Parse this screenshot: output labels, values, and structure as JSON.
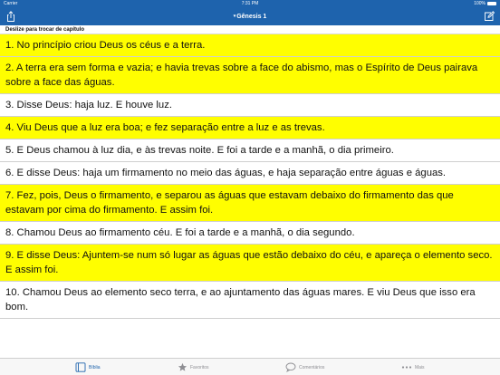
{
  "status_bar": {
    "carrier": "Carrier",
    "time": "7:31 PM",
    "battery": "100%"
  },
  "nav_bar": {
    "chevron": "▾",
    "title": "Gênesis 1",
    "left_icon": "share-icon",
    "right_icon": "compose-icon"
  },
  "hint": "Deslize para trocar de capítulo",
  "verses": [
    {
      "text": "1. No princípio criou Deus os céus e a terra.",
      "highlighted": true
    },
    {
      "text": "2. A terra era sem forma e vazia; e havia trevas sobre a face do abismo, mas o Espírito de Deus pairava sobre a face das águas.",
      "highlighted": true
    },
    {
      "text": "3. Disse Deus: haja luz. E houve luz.",
      "highlighted": false
    },
    {
      "text": "4. Viu Deus que a luz era boa; e fez separação entre a luz e as trevas.",
      "highlighted": true
    },
    {
      "text": "5. E Deus chamou à luz dia, e às trevas noite. E foi a tarde e a manhã, o dia primeiro.",
      "highlighted": false
    },
    {
      "text": "6. E disse Deus: haja um firmamento no meio das águas, e haja separação entre águas e águas.",
      "highlighted": false
    },
    {
      "text": "7. Fez, pois, Deus o firmamento, e separou as águas que estavam debaixo do firmamento das que estavam por cima do firmamento. E assim foi.",
      "highlighted": true
    },
    {
      "text": "8. Chamou Deus ao firmamento céu. E foi a tarde e a manhã, o dia segundo.",
      "highlighted": false
    },
    {
      "text": "9. E disse Deus: Ajuntem-se num só lugar as águas que estão debaixo do céu, e apareça o elemento seco. E assim foi.",
      "highlighted": true
    },
    {
      "text": "10. Chamou Deus ao elemento seco terra, e ao ajuntamento das águas mares. E viu Deus que isso era bom.",
      "highlighted": false
    }
  ],
  "tabs": [
    {
      "label": "Bíblia",
      "icon": "book-icon",
      "active": true
    },
    {
      "label": "Favoritos",
      "icon": "star-icon",
      "active": false
    },
    {
      "label": "Comentários",
      "icon": "speech-bubble-icon",
      "active": false
    },
    {
      "label": "Mais",
      "icon": "more-dots-icon",
      "active": false
    }
  ],
  "colors": {
    "accent": "#1e63ad",
    "highlight": "#fffe00"
  }
}
